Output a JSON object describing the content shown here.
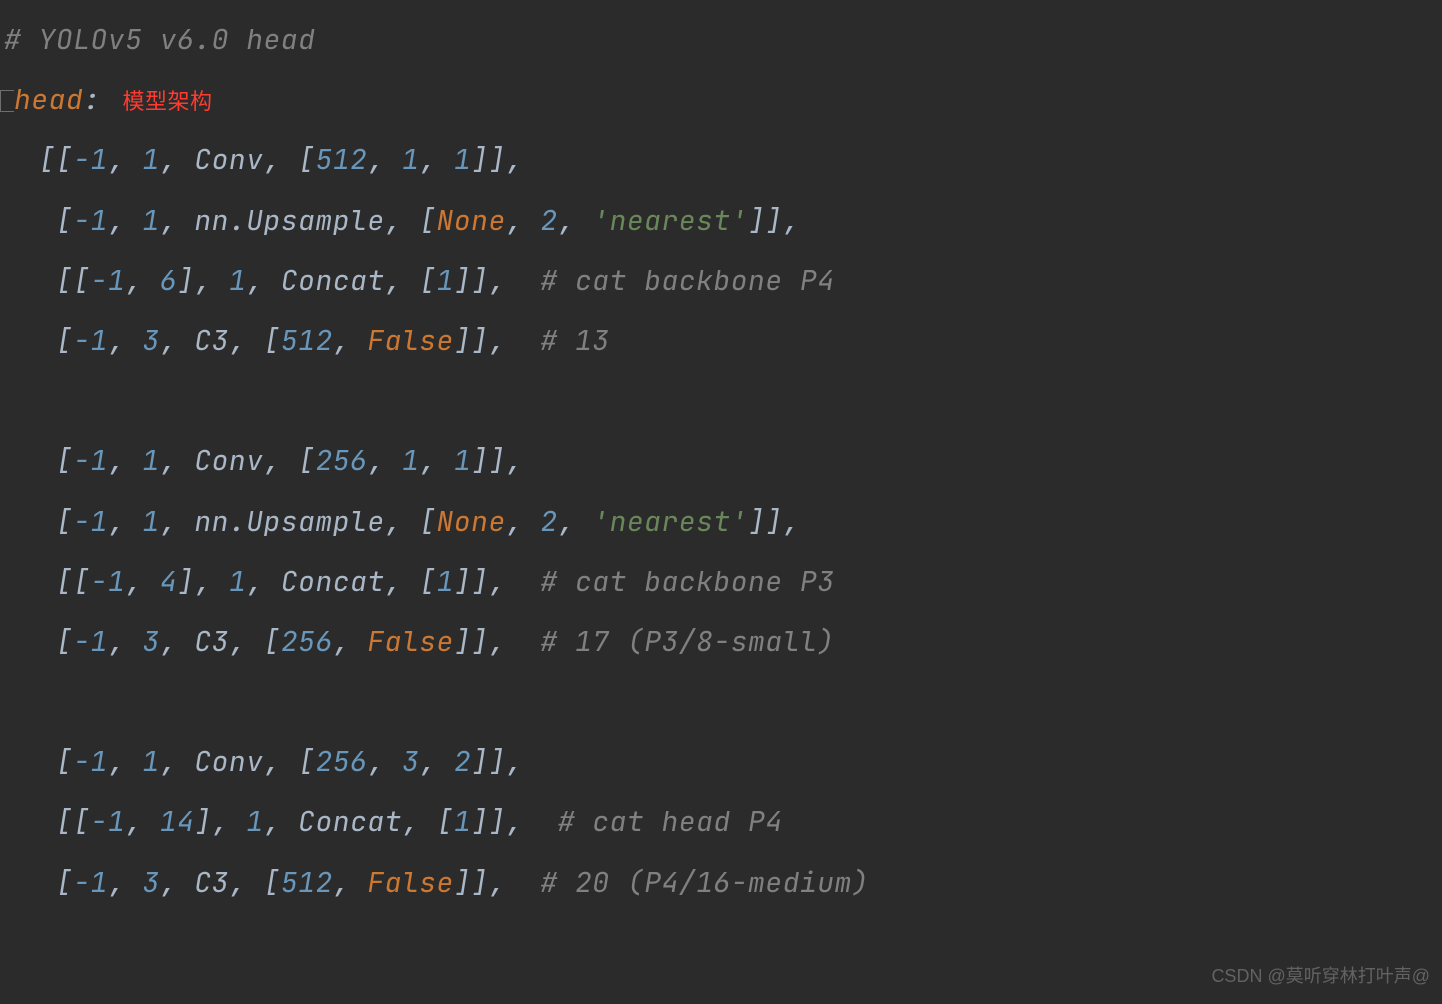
{
  "code": {
    "title_comment": "# YOLOv5 v6.0 head",
    "head_key": "head",
    "annotation_label": "模型架构",
    "lines": [
      {
        "text": "  [[-1, 1, Conv, [512, 1, 1]],",
        "comment": ""
      },
      {
        "text": "   [-1, 1, nn.Upsample, [None, 2, 'nearest']],",
        "comment": ""
      },
      {
        "text": "   [[-1, 6], 1, Concat, [1]],  ",
        "comment": "# cat backbone P4"
      },
      {
        "text": "   [-1, 3, C3, [512, False]],  ",
        "comment": "# 13"
      },
      {
        "text": "",
        "comment": ""
      },
      {
        "text": "   [-1, 1, Conv, [256, 1, 1]],",
        "comment": ""
      },
      {
        "text": "   [-1, 1, nn.Upsample, [None, 2, 'nearest']],",
        "comment": ""
      },
      {
        "text": "   [[-1, 4], 1, Concat, [1]],  ",
        "comment": "# cat backbone P3"
      },
      {
        "text": "   [-1, 3, C3, [256, False]],  ",
        "comment": "# 17 (P3/8-small)"
      },
      {
        "text": "",
        "comment": ""
      },
      {
        "text": "   [-1, 1, Conv, [256, 3, 2]],",
        "comment": ""
      },
      {
        "text": "   [[-1, 14], 1, Concat, [1]],  ",
        "comment": "# cat head P4"
      },
      {
        "text": "   [-1, 3, C3, [512, False]],  ",
        "comment": "# 20 (P4/16-medium)"
      }
    ]
  },
  "watermark": "CSDN @莫听穿林打叶声@"
}
